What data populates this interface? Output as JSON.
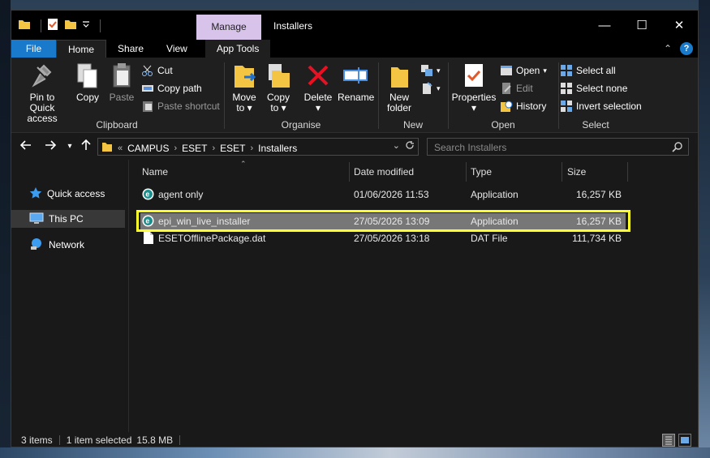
{
  "window": {
    "title": "Installers",
    "context_tab": "Manage",
    "controls": {
      "minimize": "—",
      "maximize": "☐",
      "close": "✕"
    }
  },
  "tabs": {
    "file": "File",
    "home": "Home",
    "share": "Share",
    "view": "View",
    "app_tools": "App Tools",
    "collapse": "⌃",
    "help": "?"
  },
  "ribbon": {
    "clipboard": {
      "label": "Clipboard",
      "pin_line1": "Pin to Quick",
      "pin_line2": "access",
      "copy": "Copy",
      "paste": "Paste",
      "cut": "Cut",
      "copy_path": "Copy path",
      "paste_shortcut": "Paste shortcut"
    },
    "organise": {
      "label": "Organise",
      "move_line1": "Move",
      "move_line2": "to",
      "copy_line1": "Copy",
      "copy_line2": "to",
      "delete": "Delete",
      "rename": "Rename"
    },
    "new": {
      "label": "New",
      "folder_line1": "New",
      "folder_line2": "folder"
    },
    "open": {
      "label": "Open",
      "properties": "Properties",
      "open": "Open",
      "edit": "Edit",
      "history": "History"
    },
    "select": {
      "label": "Select",
      "select_all": "Select all",
      "select_none": "Select none",
      "invert": "Invert selection"
    }
  },
  "address": {
    "prefix": "«",
    "crumbs": [
      "CAMPUS",
      "ESET",
      "ESET",
      "Installers"
    ],
    "search_placeholder": "Search Installers"
  },
  "nav": {
    "quick_access": "Quick access",
    "this_pc": "This PC",
    "network": "Network"
  },
  "columns": {
    "name": "Name",
    "date": "Date modified",
    "type": "Type",
    "size": "Size"
  },
  "files": [
    {
      "name": "agent only",
      "date": "01/06/2026 11:53",
      "type": "Application",
      "size": "16,257 KB",
      "icon": "eset-app-icon"
    },
    {
      "name": "epi_win_live_installer",
      "date": "27/05/2026 13:09",
      "type": "Application",
      "size": "16,257 KB",
      "icon": "eset-app-icon"
    },
    {
      "name": "ESETOfflinePackage.dat",
      "date": "27/05/2026 13:18",
      "type": "DAT File",
      "size": "111,734 KB",
      "icon": "file-icon"
    }
  ],
  "status": {
    "items": "3 items",
    "selected": "1 item selected",
    "size": "15.8 MB"
  },
  "colors": {
    "accent": "#1979ca",
    "manage_tab": "#d8c4ea",
    "highlight": "#ffff2a",
    "selected_row": "#777777"
  }
}
